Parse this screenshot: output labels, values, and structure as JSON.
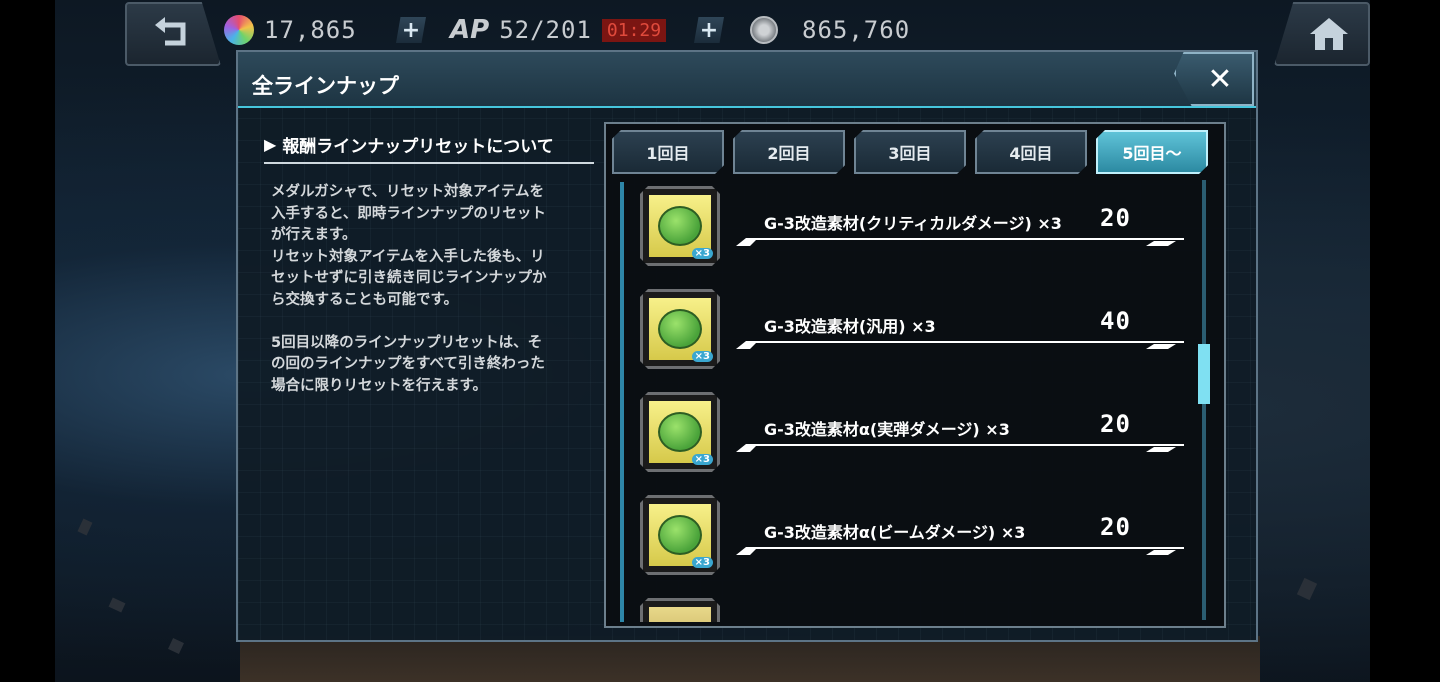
{
  "top_bar": {
    "gems": "17,865",
    "ap_label": "AP",
    "ap_value": "52/201",
    "ap_timer": "01:29",
    "coins": "865,760"
  },
  "panel": {
    "title": "全ラインナップ",
    "close_label": "✕"
  },
  "info": {
    "heading": "報酬ラインナップリセットについて",
    "body": "メダルガシャで、リセット対象アイテムを\n入手すると、即時ラインナップのリセット\nが行えます。\nリセット対象アイテムを入手した後も、リ\nセットせずに引き続き同じラインナップか\nら交換することも可能です。\n\n5回目以降のラインナップリセットは、そ\nの回のラインナップをすべて引き終わった\n場合に限りリセットを行えます。"
  },
  "tabs": [
    {
      "label": "1回目",
      "active": false
    },
    {
      "label": "2回目",
      "active": false
    },
    {
      "label": "3回目",
      "active": false
    },
    {
      "label": "4回目",
      "active": false
    },
    {
      "label": "5回目～",
      "active": true
    }
  ],
  "items": [
    {
      "name": "G-3改造素材(クリティカルダメージ) ×3",
      "price": "20",
      "badge": "×3"
    },
    {
      "name": "G-3改造素材(汎用) ×3",
      "price": "40",
      "badge": "×3"
    },
    {
      "name": "G-3改造素材α(実弾ダメージ) ×3",
      "price": "20",
      "badge": "×3"
    },
    {
      "name": "G-3改造素材α(ビームダメージ) ×3",
      "price": "20",
      "badge": "×3"
    }
  ]
}
